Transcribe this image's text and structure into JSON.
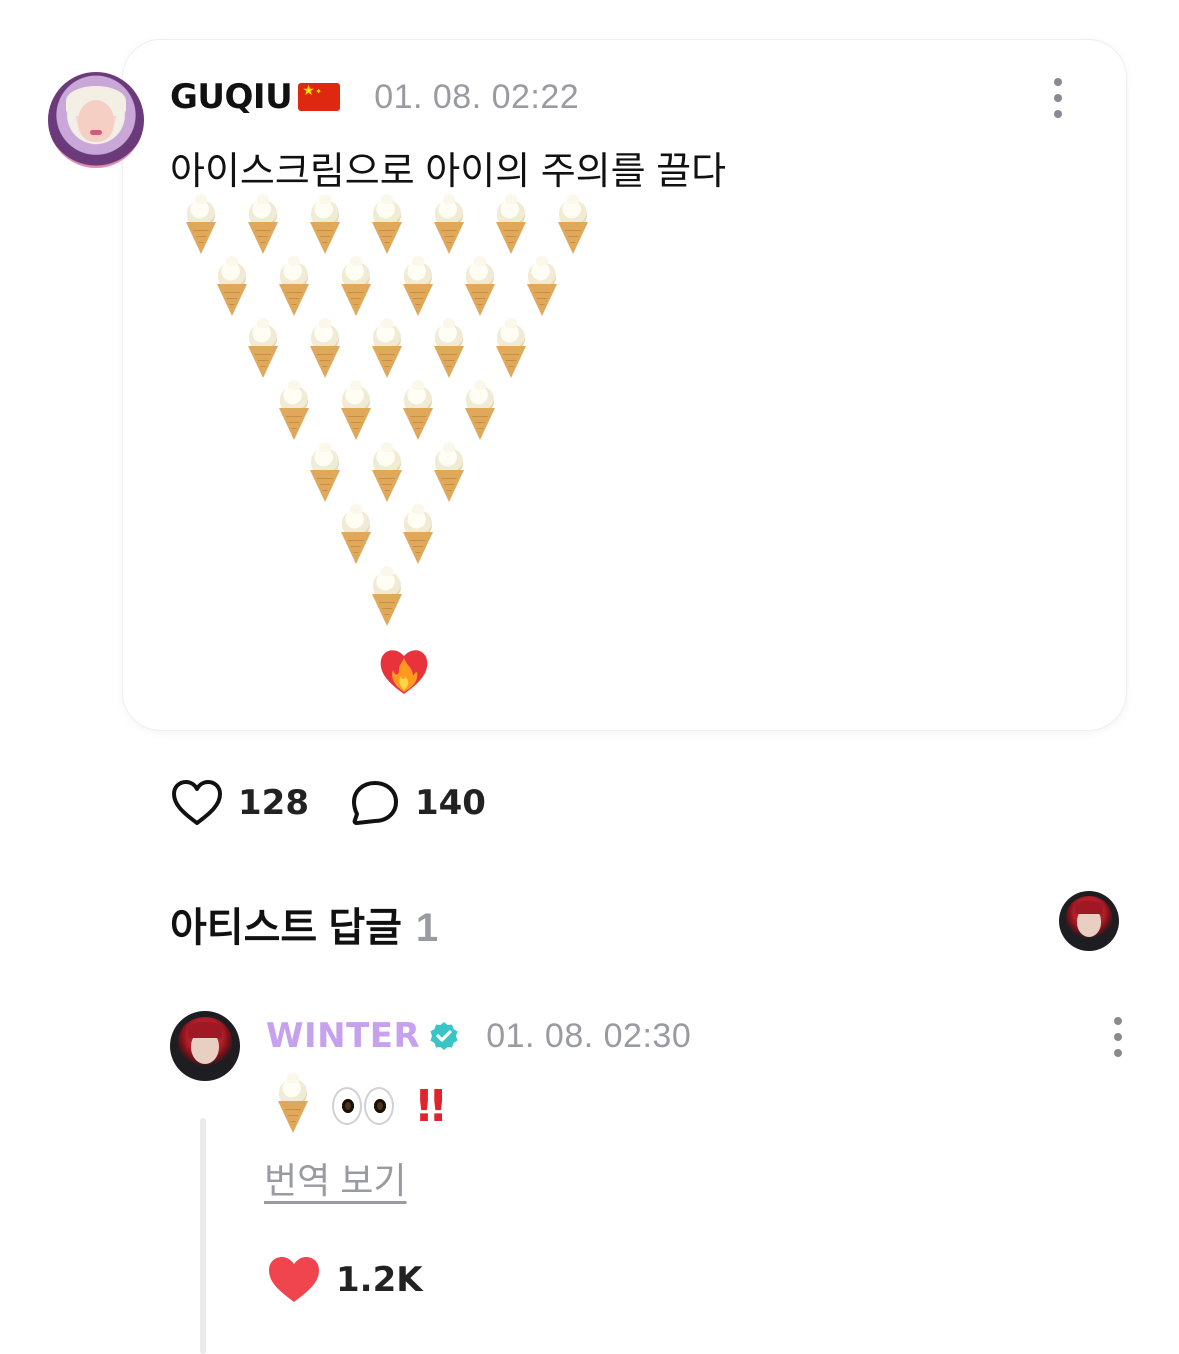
{
  "post": {
    "author": "GUQIU",
    "flag": "CN-flag",
    "timestamp": "01. 08. 02:22",
    "text": "아이스크림으로 아이의 주의를 끌다",
    "emoji_pattern": {
      "emoji": "ice-cream-cone",
      "rows": [
        7,
        6,
        5,
        4,
        3,
        2,
        1
      ],
      "ending_emoji": "heart-on-fire"
    },
    "more_icon": "more-vertical-icon"
  },
  "actions": {
    "likes": "128",
    "comments": "140",
    "like_icon": "heart-outline-icon",
    "comment_icon": "speech-bubble-icon"
  },
  "artist_replies": {
    "title": "아티스트 답글",
    "count": "1"
  },
  "reply": {
    "author": "WINTER",
    "verified": true,
    "timestamp": "01. 08. 02:30",
    "content_emojis": [
      "ice-cream-cone",
      "eyes",
      "double-exclamation"
    ],
    "translate_label": "번역 보기",
    "likes": "1.2K",
    "like_icon": "heart-filled-icon"
  },
  "colors": {
    "author_accent": "#c6a1ee",
    "muted": "#9a9aa3",
    "like_red": "#f0454e",
    "verified_teal": "#39c5c5"
  }
}
